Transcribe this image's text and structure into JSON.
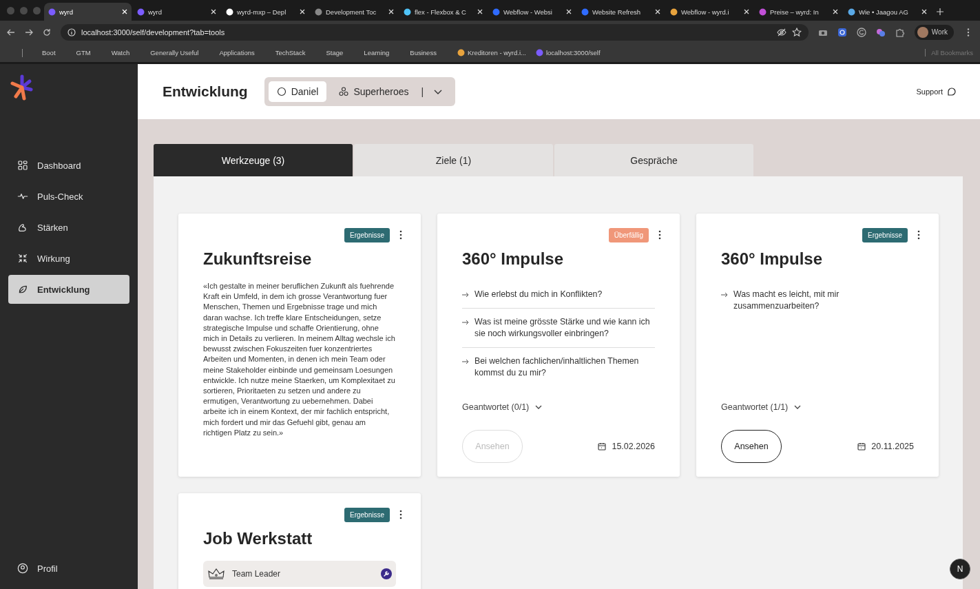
{
  "browser": {
    "tabs": [
      {
        "title": "wyrd",
        "selected": true
      },
      {
        "title": "wyrd",
        "selected": false
      },
      {
        "title": "wyrd-mxp – Depl",
        "selected": false
      },
      {
        "title": "Development Toc",
        "selected": false
      },
      {
        "title": "flex - Flexbox & C",
        "selected": false
      },
      {
        "title": "Webflow - Websi",
        "selected": false
      },
      {
        "title": "Website Refresh",
        "selected": false
      },
      {
        "title": "Webflow - wyrd.i",
        "selected": false
      },
      {
        "title": "Preise – wyrd: In",
        "selected": false
      },
      {
        "title": "Wie • Jaagou AG",
        "selected": false
      }
    ],
    "address": "localhost:3000/self/development?tab=tools",
    "profile": "Work",
    "bookmarks": [
      "Boot",
      "GTM",
      "Watch",
      "Generally Useful",
      "Applications",
      "TechStack",
      "Stage",
      "Learning",
      "Business",
      "Kreditoren - wyrd.i...",
      "localhost:3000/self"
    ],
    "all_bookmarks": "All Bookmarks"
  },
  "sidebar": {
    "items": [
      {
        "label": "Dashboard",
        "selected": false
      },
      {
        "label": "Puls-Check",
        "selected": false
      },
      {
        "label": "Stärken",
        "selected": false
      },
      {
        "label": "Wirkung",
        "selected": false
      },
      {
        "label": "Entwicklung",
        "selected": true
      }
    ],
    "profile": "Profil"
  },
  "header": {
    "title": "Entwicklung",
    "segments": [
      {
        "label": "Daniel",
        "selected": true
      },
      {
        "label": "Superheroes",
        "selected": false
      }
    ],
    "separator": "|",
    "support": "Support"
  },
  "tabs": [
    {
      "label": "Werkzeuge (3)",
      "selected": true
    },
    {
      "label": "Ziele (1)",
      "selected": false
    },
    {
      "label": "Gespräche",
      "selected": false
    }
  ],
  "cards": [
    {
      "kind": "vision",
      "title": "Zukunftsreise",
      "badge": {
        "label": "Ergebnisse",
        "color": "#2d6b72"
      },
      "text": "«Ich gestalte in meiner beruflichen Zukunft als fuehrende Kraft ein Umfeld, in dem ich grosse Verantwortung fuer Menschen, Themen und Ergebnisse trage und mich daran wachse. Ich treffe klare Entscheidungen, setze strategische Impulse und schaffe Orientierung, ohne mich in Details zu verlieren. In meinem Alltag wechsle ich bewusst zwischen Fokuszeiten fuer konzentriertes Arbeiten und Momenten, in denen ich mein Team oder meine Stakeholder einbinde und gemeinsam Loesungen entwickle. Ich nutze meine Staerken, um Komplexitaet zu sortieren, Prioritaeten zu setzen und andere zu ermutigen, Verantwortung zu uebernehmen. Dabei arbeite ich in einem Kontext, der mir fachlich entspricht, mich fordert und mir das Gefuehl gibt, genau am richtigen Platz zu sein.»"
    },
    {
      "kind": "questions",
      "title": "360° Impulse",
      "badge": {
        "label": "Überfällig",
        "color": "#f09779"
      },
      "questions": [
        "Wie erlebst du mich in Konflikten?",
        "Was ist meine grösste Stärke und wie kann ich sie noch wirkungsvoller einbringen?",
        "Bei welchen fachlichen/inhaltlichen Themen kommst du zu mir?"
      ],
      "answered": "Geantwortet (0/1)",
      "button": {
        "label": "Ansehen",
        "disabled": true
      },
      "date": "15.02.2026"
    },
    {
      "kind": "questions",
      "title": "360° Impulse",
      "badge": {
        "label": "Ergebnisse",
        "color": "#2d6b72"
      },
      "questions": [
        "Was macht es leicht, mit mir zusammenzuarbeiten?"
      ],
      "answered": "Geantwortet (1/1)",
      "button": {
        "label": "Ansehen",
        "disabled": false
      },
      "date": "20.11.2025"
    },
    {
      "kind": "job",
      "title": "Job Werkstatt",
      "badge": {
        "label": "Ergebnisse",
        "color": "#2d6b72"
      },
      "role": "Team Leader"
    }
  ],
  "dev_badge": "N"
}
